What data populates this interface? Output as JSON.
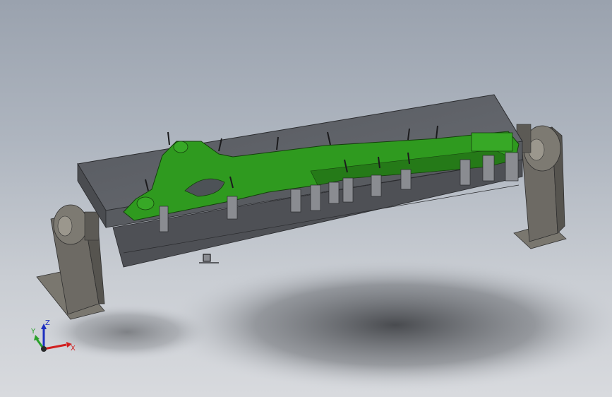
{
  "window": {
    "background_top": "#9aa2ae",
    "background_bottom": "#d8dade"
  },
  "model": {
    "part_color": "#2f9a1f",
    "fixture_color": "#5e6066",
    "support_color": "#6d6a64"
  },
  "triad": {
    "x_label": "X",
    "y_label": "Y",
    "z_label": "Z",
    "x_color": "#d11f1f",
    "y_color": "#2aa02a",
    "z_color": "#1e2fbf"
  }
}
